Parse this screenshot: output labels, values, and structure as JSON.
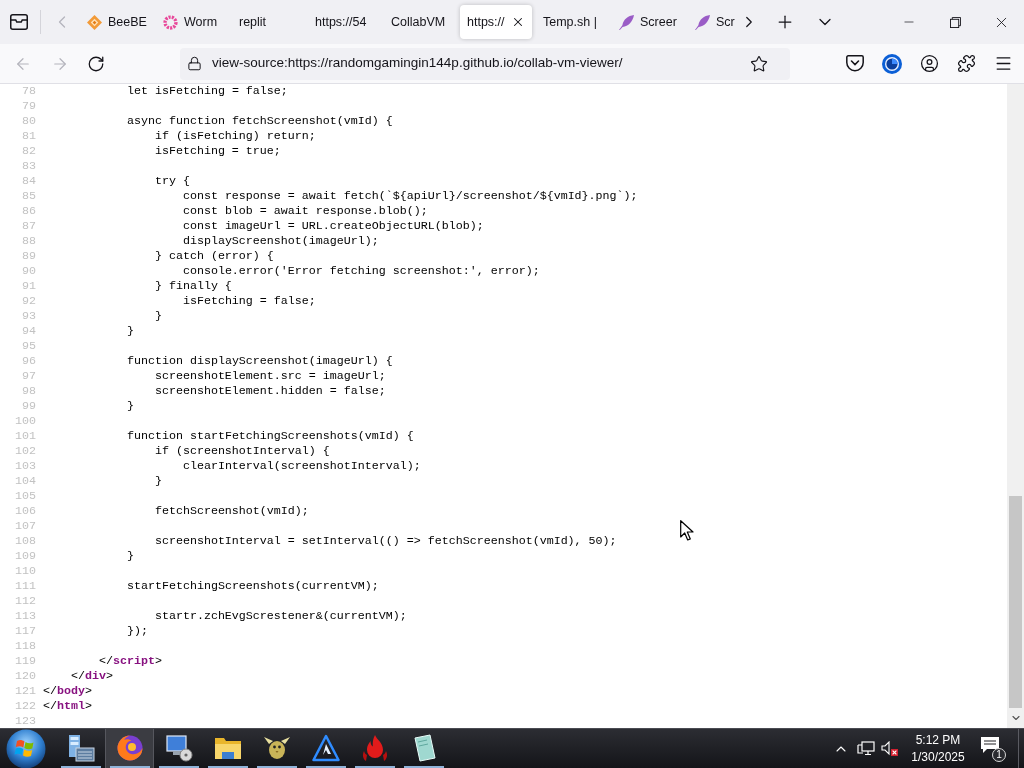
{
  "browser": {
    "tab_scroll": {
      "left_disabled": true,
      "right_disabled": false
    },
    "tabs": [
      {
        "title": "BeeBE",
        "selected": false
      },
      {
        "title": "Worm",
        "selected": false
      },
      {
        "title": "replit",
        "selected": false
      },
      {
        "title": "https://54",
        "selected": false
      },
      {
        "title": "CollabVM",
        "selected": false
      },
      {
        "title": "https://",
        "selected": true
      },
      {
        "title": "Temp.sh |",
        "selected": false
      },
      {
        "title": "Screer",
        "selected": false
      },
      {
        "title": "Scr",
        "selected": false
      }
    ],
    "navigation": {
      "back_disabled": true,
      "forward_disabled": true
    },
    "address_bar": {
      "url": "view-source:https://randomgamingin144p.github.io/collab-vm-viewer/"
    }
  },
  "source_view": {
    "lines": [
      {
        "number": "78",
        "kind": "code",
        "text": "            let isFetching = false;"
      },
      {
        "number": "79"
      },
      {
        "number": "80",
        "kind": "code",
        "text": "            async function fetchScreenshot(vmId) {"
      },
      {
        "number": "81",
        "kind": "code",
        "text": "                if (isFetching) return;"
      },
      {
        "number": "82",
        "kind": "code",
        "text": "                isFetching = true;"
      },
      {
        "number": "83"
      },
      {
        "number": "84",
        "kind": "code",
        "text": "                try {"
      },
      {
        "number": "85",
        "kind": "code",
        "text": "                    const response = await fetch(`${apiUrl}/screenshot/${vmId}.png`);"
      },
      {
        "number": "86",
        "kind": "code",
        "text": "                    const blob = await response.blob();"
      },
      {
        "number": "87",
        "kind": "code",
        "text": "                    const imageUrl = URL.createObjectURL(blob);"
      },
      {
        "number": "88",
        "kind": "code",
        "text": "                    displayScreenshot(imageUrl);"
      },
      {
        "number": "89",
        "kind": "code",
        "text": "                } catch (error) {"
      },
      {
        "number": "90",
        "kind": "code",
        "text": "                    console.error('Error fetching screenshot:', error);"
      },
      {
        "number": "91",
        "kind": "code",
        "text": "                } finally {"
      },
      {
        "number": "92",
        "kind": "code",
        "text": "                    isFetching = false;"
      },
      {
        "number": "93",
        "kind": "code",
        "text": "                }"
      },
      {
        "number": "94",
        "kind": "code",
        "text": "            }"
      },
      {
        "number": "95"
      },
      {
        "number": "96",
        "kind": "code",
        "text": "            function displayScreenshot(imageUrl) {"
      },
      {
        "number": "97",
        "kind": "code",
        "text": "                screenshotElement.src = imageUrl;"
      },
      {
        "number": "98",
        "kind": "code",
        "text": "                screenshotElement.hidden = false;"
      },
      {
        "number": "99",
        "kind": "code",
        "text": "            }"
      },
      {
        "number": "100"
      },
      {
        "number": "101",
        "kind": "code",
        "text": "            function startFetchingScreenshots(vmId) {"
      },
      {
        "number": "102",
        "kind": "code",
        "text": "                if (screenshotInterval) {"
      },
      {
        "number": "103",
        "kind": "code",
        "text": "                    clearInterval(screenshotInterval);"
      },
      {
        "number": "104",
        "kind": "code",
        "text": "                }"
      },
      {
        "number": "105"
      },
      {
        "number": "106",
        "kind": "code",
        "text": "                fetchScreenshot(vmId);"
      },
      {
        "number": "107"
      },
      {
        "number": "108",
        "kind": "code",
        "text": "                screenshotInterval = setInterval(() => fetchScreenshot(vmId), 50);"
      },
      {
        "number": "109",
        "kind": "code",
        "text": "            }"
      },
      {
        "number": "110"
      },
      {
        "number": "111",
        "kind": "code",
        "text": "            startFetchingScreenshots(currentVM);"
      },
      {
        "number": "112"
      },
      {
        "number": "113",
        "kind": "code",
        "text": "                startr.zchEvgScrestener&(currentVM);"
      },
      {
        "number": "117",
        "kind": "code",
        "text": "            });"
      },
      {
        "number": "118"
      },
      {
        "number": "119",
        "kind": "markup",
        "segments": [
          {
            "kind": "plain",
            "text": "        </"
          },
          {
            "kind": "tag",
            "text": "script"
          },
          {
            "kind": "plain",
            "text": ">"
          }
        ]
      },
      {
        "number": "120",
        "kind": "markup",
        "segments": [
          {
            "kind": "plain",
            "text": "    </"
          },
          {
            "kind": "tag",
            "text": "div"
          },
          {
            "kind": "plain",
            "text": ">"
          }
        ]
      },
      {
        "number": "121",
        "kind": "markup",
        "segments": [
          {
            "kind": "plain",
            "text": "</"
          },
          {
            "kind": "tag",
            "text": "body"
          },
          {
            "kind": "plain",
            "text": ">"
          }
        ]
      },
      {
        "number": "122",
        "kind": "markup",
        "segments": [
          {
            "kind": "plain",
            "text": "</"
          },
          {
            "kind": "tag",
            "text": "html"
          },
          {
            "kind": "plain",
            "text": ">"
          }
        ]
      },
      {
        "number": "123"
      }
    ]
  },
  "taskbar": {
    "apps": [
      {
        "selected": false,
        "running": true
      },
      {
        "selected": true,
        "running": true
      },
      {
        "selected": false,
        "running": true
      },
      {
        "selected": false,
        "running": true
      },
      {
        "selected": false,
        "running": true
      },
      {
        "selected": false,
        "running": true
      },
      {
        "selected": false,
        "running": true
      },
      {
        "selected": false,
        "running": true
      }
    ],
    "clock": {
      "time": "5:12 PM",
      "date": "1/30/2025"
    },
    "notifications": {
      "count": "1"
    }
  }
}
